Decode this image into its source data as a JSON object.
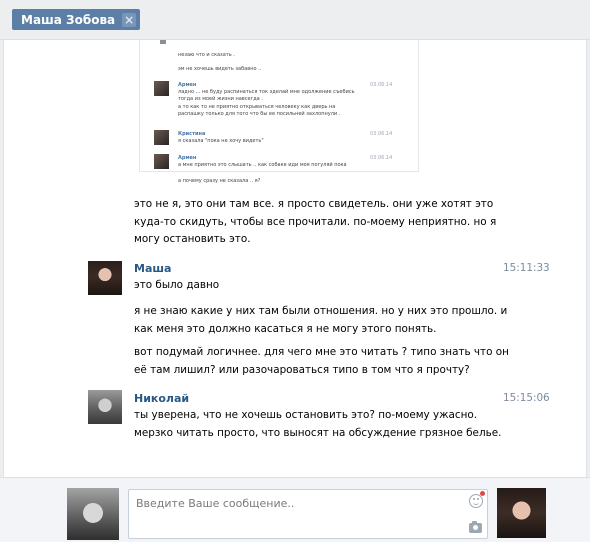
{
  "tab": {
    "title": "Маша Зобова",
    "close_icon": "close-icon"
  },
  "embedded": {
    "lines_top": [
      "незаю что и сказать .",
      "эм не хочешь видеть забавно .."
    ],
    "messages": [
      {
        "name": "Армен",
        "date": "03.06.14",
        "lines": [
          "ладно ... не буду распинаться ток зделай мне одолжение съебись",
          "тогда из моей жизни навсегда .",
          "а то как то не приятно открываться человеку как дверь на",
          "распашку только для того что бы ее посильней захлопнули ."
        ]
      },
      {
        "name": "Кристина",
        "date": "03.06.14",
        "lines": [
          "я сказала \"пока не хочу видеть\""
        ]
      },
      {
        "name": "Армен",
        "date": "03.06.14",
        "lines": [
          "а мне приятно это слышать .. как собаке иди моя погуляй пока",
          "а почему сразу не сказала .. я?"
        ]
      }
    ]
  },
  "messages": [
    {
      "id": "cont",
      "lines": [
        "это не я, это они там все. я просто свидетель. они уже хотят это",
        "куда-то скидуть, чтобы все прочитали. по-моему неприятно. но я",
        "могу остановить это."
      ]
    },
    {
      "id": "masha",
      "name": "Маша",
      "time": "15:11:33",
      "paragraphs": [
        [
          "это было давно"
        ],
        [
          "я не знаю какие у них там были отношения. но у них это прошло. и",
          "как меня это должно касаться я не могу этого понять."
        ],
        [
          "вот подумай логичнее. для чего мне это читать ? типо знать что он",
          "её там лишил? или разочароваться типо в том что я прочту?"
        ]
      ]
    },
    {
      "id": "nikolai",
      "name": "Николай",
      "time": "15:15:06",
      "paragraphs": [
        [
          "ты уверена, что не хочешь остановить это? по-моему ужасно.",
          "мерзко читать просто, что выносят на обсуждение грязное белье."
        ]
      ]
    }
  ],
  "composer": {
    "placeholder": "Введите Ваше сообщение..",
    "smile_icon": "smile-icon",
    "camera_icon": "camera-icon"
  }
}
